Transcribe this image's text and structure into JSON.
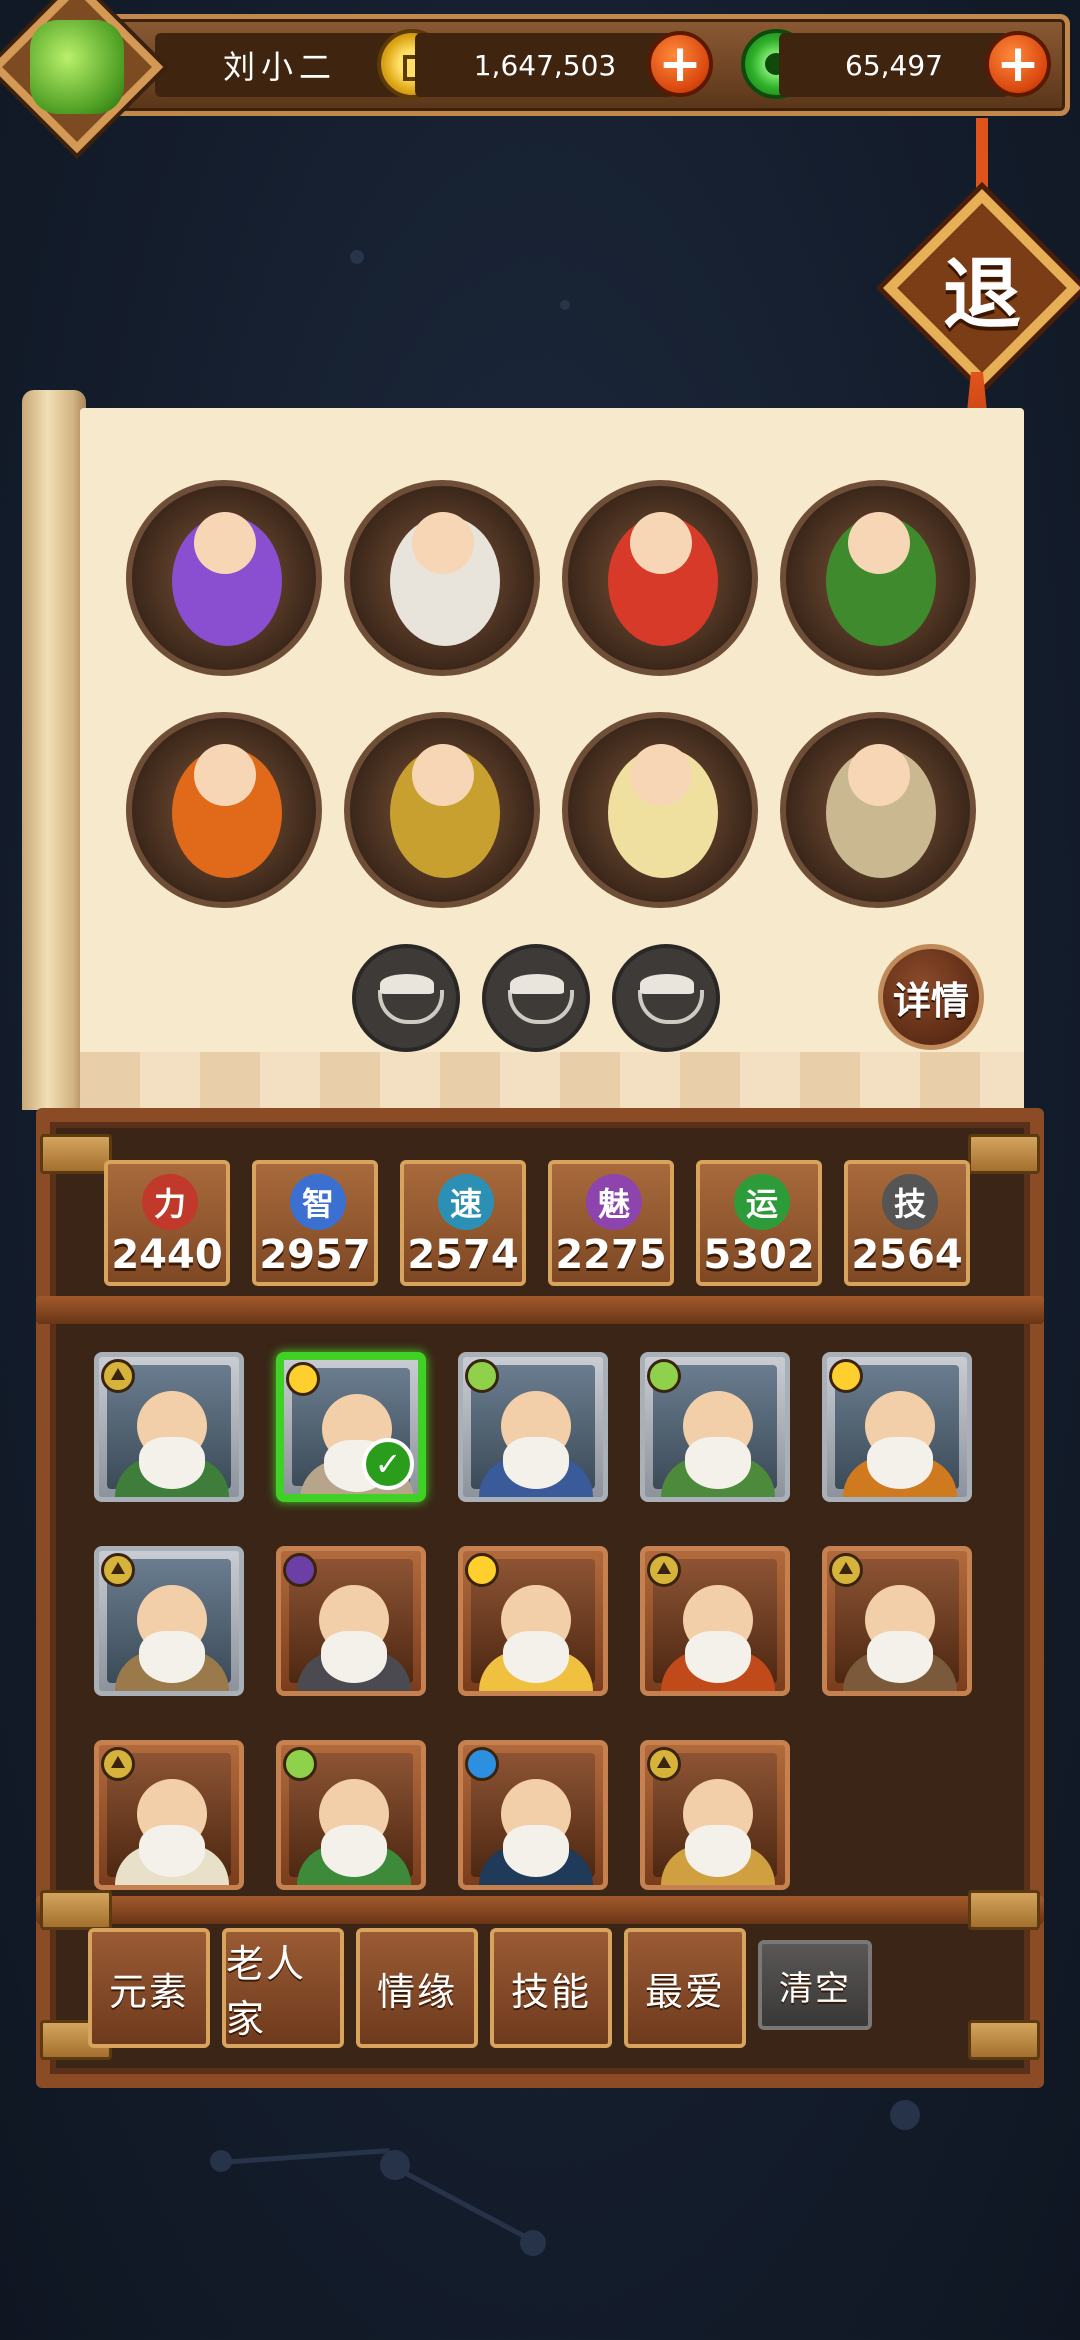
{
  "player": {
    "name": "刘小二",
    "gold": "1,647,503",
    "jade": "65,497"
  },
  "exit_label": "退",
  "detail_label": "详情",
  "stats": [
    {
      "glyph": "力",
      "value": "2440",
      "color": "#c0392b"
    },
    {
      "glyph": "智",
      "value": "2957",
      "color": "#3b6fd0"
    },
    {
      "glyph": "速",
      "value": "2574",
      "color": "#2c8fb4"
    },
    {
      "glyph": "魅",
      "value": "2275",
      "color": "#8e44ad"
    },
    {
      "glyph": "运",
      "value": "5302",
      "color": "#2e9b3a"
    },
    {
      "glyph": "技",
      "value": "2564",
      "color": "#555555"
    }
  ],
  "tabs": [
    "元素",
    "老人家",
    "情缘",
    "技能",
    "最爱"
  ],
  "clear_label": "清空",
  "team_slots": [
    {
      "icon": "purple-queen-portrait"
    },
    {
      "icon": "ghost-pair-portrait"
    },
    {
      "icon": "santa-sleigh-portrait"
    },
    {
      "icon": "warrior-portrait"
    },
    {
      "icon": "god-of-wealth-portrait"
    },
    {
      "icon": "crossed-staff-portrait"
    },
    {
      "icon": "immortal-sage-portrait"
    },
    {
      "icon": "gold-sack-grandma-portrait"
    }
  ],
  "empty_slots": 3,
  "cards": [
    {
      "element": "earth",
      "frame": "gray",
      "selected": false
    },
    {
      "element": "sun",
      "frame": "gray",
      "selected": true
    },
    {
      "element": "leaf",
      "frame": "gray",
      "selected": false
    },
    {
      "element": "leaf",
      "frame": "gray",
      "selected": false
    },
    {
      "element": "sun",
      "frame": "gray",
      "selected": false
    },
    {
      "element": "earth",
      "frame": "gray",
      "selected": false
    },
    {
      "element": "moon",
      "frame": "brown",
      "selected": false
    },
    {
      "element": "sun",
      "frame": "brown",
      "selected": false
    },
    {
      "element": "earth",
      "frame": "brown",
      "selected": false
    },
    {
      "element": "earth",
      "frame": "brown",
      "selected": false
    },
    {
      "element": "earth",
      "frame": "brown",
      "selected": false
    },
    {
      "element": "leaf",
      "frame": "brown",
      "selected": false
    },
    {
      "element": "water",
      "frame": "brown",
      "selected": false
    },
    {
      "element": "earth",
      "frame": "brown",
      "selected": false
    }
  ]
}
